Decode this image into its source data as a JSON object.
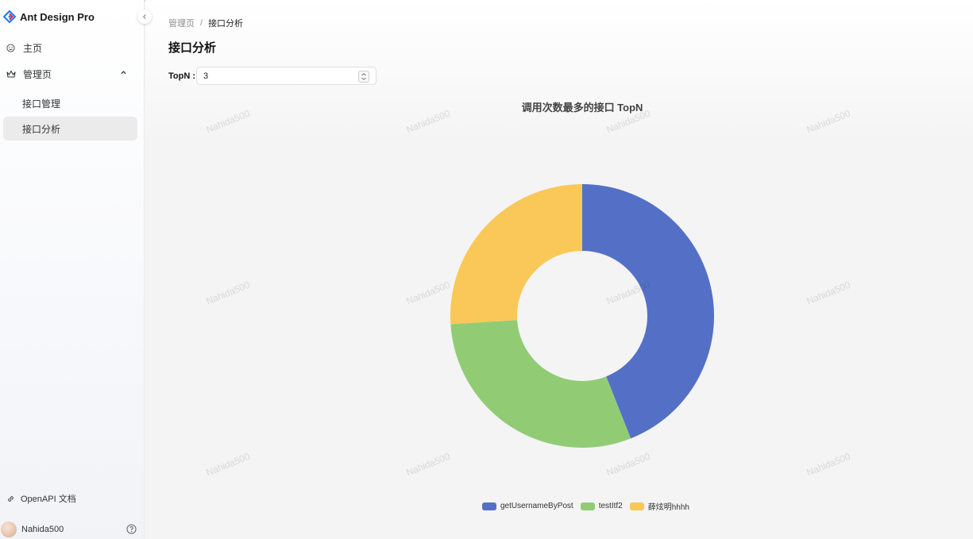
{
  "app": {
    "title": "Ant Design Pro"
  },
  "sidebar": {
    "items": [
      {
        "label": "主页",
        "icon": "smile-icon"
      },
      {
        "label": "管理页",
        "icon": "crown-icon"
      },
      {
        "label": "接口管理"
      },
      {
        "label": "接口分析"
      }
    ],
    "doc_link": "OpenAPI 文档",
    "user": "Nahida500"
  },
  "breadcrumb": {
    "parent": "管理页",
    "separator": "/",
    "current": "接口分析"
  },
  "page": {
    "title": "接口分析"
  },
  "form": {
    "topn_label": "TopN :",
    "topn_value": "3"
  },
  "watermark": "Nahida500",
  "colors": {
    "blue": "#5470c6",
    "green": "#91cc75",
    "yellow": "#fac858",
    "active_bg": "#ebebeb"
  },
  "chart_data": {
    "type": "pie",
    "title": "调用次数最多的接口 TopN",
    "donut": true,
    "legend_position": "bottom-center",
    "categories": [
      "getUsernameByPost",
      "testItf2",
      "薛炫明hhhh"
    ],
    "values": [
      44,
      30,
      26
    ],
    "colors": [
      "#5470c6",
      "#91cc75",
      "#fac858"
    ]
  }
}
